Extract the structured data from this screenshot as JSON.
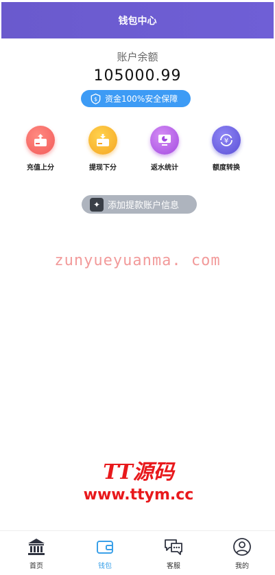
{
  "header": {
    "title": "钱包中心"
  },
  "balance": {
    "label": "账户余额",
    "value": "105000.99",
    "secure_badge": "资金100%安全保障"
  },
  "actions": [
    {
      "label": "充值上分",
      "icon": "deposit-icon",
      "color": "#f25b5b"
    },
    {
      "label": "提现下分",
      "icon": "withdraw-icon",
      "color": "#f5a623"
    },
    {
      "label": "返水统计",
      "icon": "stats-icon",
      "color": "#a34be0"
    },
    {
      "label": "额度转换",
      "icon": "exchange-icon",
      "color": "#5a4fd6"
    }
  ],
  "add_account": {
    "label": "添加提款账户信息"
  },
  "watermark": "zunyueyuanma. com",
  "logo": {
    "name": "TT源码",
    "url": "www.ttym.cc"
  },
  "tabbar": [
    {
      "label": "首页",
      "icon": "home-icon",
      "active": false
    },
    {
      "label": "钱包",
      "icon": "wallet-icon",
      "active": true
    },
    {
      "label": "客服",
      "icon": "chat-icon",
      "active": false
    },
    {
      "label": "我的",
      "icon": "user-icon",
      "active": false
    }
  ],
  "colors": {
    "header": "#6a5acd",
    "accent": "#3d9bf5",
    "tab_active": "#3aa0e8"
  }
}
